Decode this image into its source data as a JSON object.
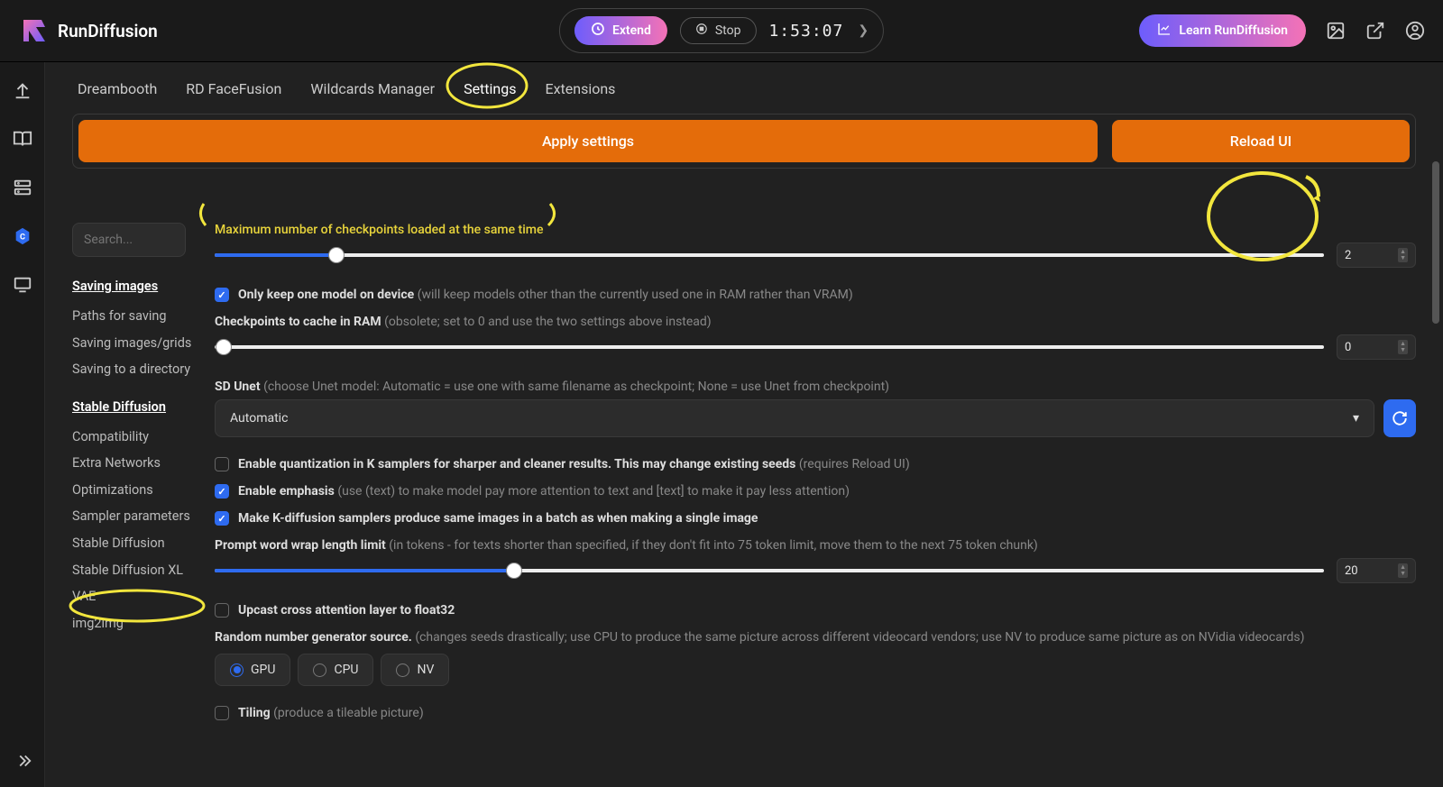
{
  "brand": "RunDiffusion",
  "top": {
    "extend": "Extend",
    "stop": "Stop",
    "timer": "1:53:07",
    "learn": "Learn RunDiffusion"
  },
  "tabs": [
    "Dreambooth",
    "RD FaceFusion",
    "Wildcards Manager",
    "Settings",
    "Extensions"
  ],
  "active_tab": "Settings",
  "actions": {
    "apply": "Apply settings",
    "reload": "Reload UI"
  },
  "search": {
    "placeholder": "Search..."
  },
  "side": {
    "group1_head": "Saving images",
    "group1": [
      "Paths for saving",
      "Saving images/grids",
      "Saving to a directory"
    ],
    "group2_head": "Stable Diffusion",
    "group2": [
      "Compatibility",
      "Extra Networks",
      "Optimizations",
      "Sampler parameters",
      "Stable Diffusion",
      "Stable Diffusion XL",
      "VAE",
      "img2img"
    ]
  },
  "settings": {
    "max_ckpt": {
      "label": "Maximum number of checkpoints loaded at the same time",
      "value": "2",
      "fill_pct": 11
    },
    "only_keep": {
      "label": "Only keep one model on device",
      "muted": "(will keep models other than the currently used one in RAM rather than VRAM)",
      "checked": true
    },
    "cache_ram": {
      "label": "Checkpoints to cache in RAM",
      "muted": "(obsolete; set to 0 and use the two settings above instead)",
      "value": "0",
      "fill_pct": 0
    },
    "sd_unet": {
      "label": "SD Unet",
      "muted": "(choose Unet model: Automatic = use one with same filename as checkpoint; None = use Unet from checkpoint)",
      "value": "Automatic"
    },
    "quant": {
      "label": "Enable quantization in K samplers for sharper and cleaner results. This may change existing seeds",
      "muted": "(requires Reload UI)",
      "checked": false
    },
    "emphasis": {
      "label": "Enable emphasis",
      "muted": "(use (text) to make model pay more attention to text and [text] to make it pay less attention)",
      "checked": true
    },
    "kdiff_batch": {
      "label": "Make K-diffusion samplers produce same images in a batch as when making a single image",
      "checked": true
    },
    "wrap": {
      "label": "Prompt word wrap length limit",
      "muted": "(in tokens - for texts shorter than specified, if they don't fit into 75 token limit, move them to the next 75 token chunk)",
      "value": "20",
      "fill_pct": 27
    },
    "upcast": {
      "label": "Upcast cross attention layer to float32",
      "checked": false
    },
    "rng": {
      "label": "Random number generator source.",
      "muted": "(changes seeds drastically; use CPU to produce the same picture across different videocard vendors; use NV to produce same picture as on NVidia videocards)",
      "options": [
        "GPU",
        "CPU",
        "NV"
      ],
      "value": "GPU"
    },
    "tiling": {
      "label": "Tiling",
      "muted": "(produce a tileable picture)",
      "checked": false
    }
  }
}
